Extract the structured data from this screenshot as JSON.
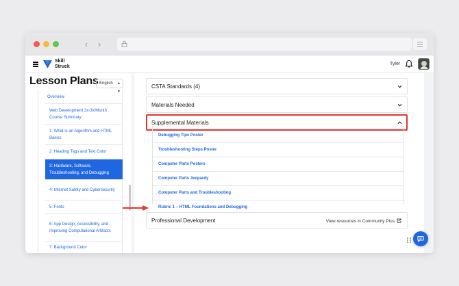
{
  "browser": {
    "back_icon": "chevron-left-icon",
    "forward_icon": "chevron-right-icon",
    "lock_icon": "lock-icon",
    "menu_icon": "menu-lines-icon"
  },
  "header": {
    "brand_line1": "Skill",
    "brand_line2": "Struck",
    "user_name": "Tyler",
    "bell_icon": "bell-icon"
  },
  "sidebar": {
    "title": "Lesson Plans",
    "language": "English",
    "overview": "Overview",
    "items": [
      {
        "label": "Web Development 2x-3x/Month Course Summary",
        "active": false
      },
      {
        "label": "1: What is an Algorithm and HTML Basics",
        "active": false
      },
      {
        "label": "2: Heading Tags and Text Color",
        "active": false
      },
      {
        "label": "3: Hardware, Software, Troubleshooting, and Debugging",
        "active": true
      },
      {
        "label": "4: Internet Safety and Cybersecurity",
        "active": false
      },
      {
        "label": "5: Fonts",
        "active": false
      },
      {
        "label": "6: App Design, Accessibility, and Improving Computational Artifacts",
        "active": false
      },
      {
        "label": "7: Background Color",
        "active": false
      }
    ]
  },
  "main": {
    "sections": [
      {
        "label": "CSTA Standards (4)"
      },
      {
        "label": "Materials Needed"
      },
      {
        "label": "Supplemental Materials"
      }
    ],
    "supplemental_items": [
      "Debugging Tips Poster",
      "Troubleshooting Steps Poster",
      "Computer Parts Posters",
      "Computer Parts Jeopardy",
      "Computer Parts and Troubleshooting",
      "Rubric 1 – HTML Foundations and Debugging"
    ],
    "professional_development": {
      "label": "Professional Development",
      "link": "View resources in Community Plus"
    }
  },
  "colors": {
    "accent": "#1f67e0",
    "highlight": "#e8332a"
  }
}
